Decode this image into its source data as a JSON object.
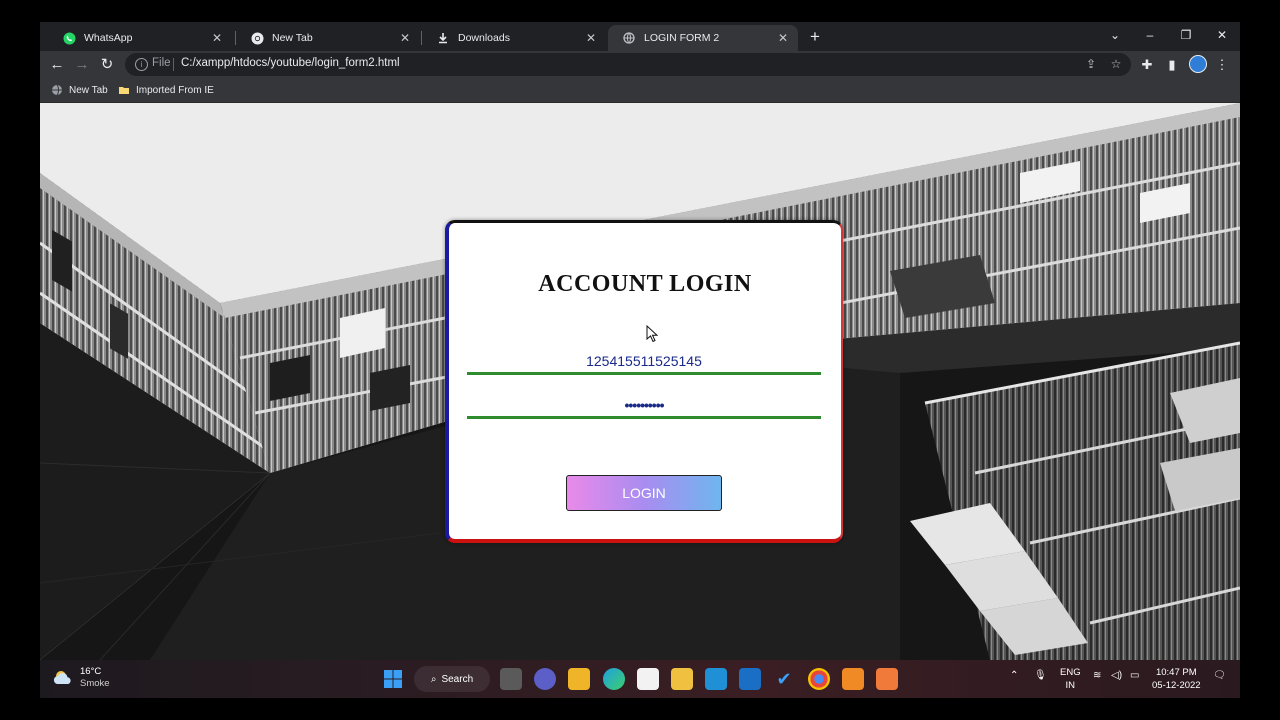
{
  "browser": {
    "tabs": [
      {
        "label": "WhatsApp",
        "icon": "whatsapp-icon"
      },
      {
        "label": "New Tab",
        "icon": "chrome-icon"
      },
      {
        "label": "Downloads",
        "icon": "download-icon"
      },
      {
        "label": "LOGIN FORM 2",
        "icon": "globe-icon",
        "active": true
      }
    ],
    "address": {
      "scheme_label": "File",
      "url": "C:/xampp/htdocs/youtube/login_form2.html"
    },
    "bookmarks": [
      {
        "label": "New Tab",
        "icon": "globe-icon"
      },
      {
        "label": "Imported From IE",
        "icon": "folder-icon"
      }
    ]
  },
  "login": {
    "title": "ACCOUNT LOGIN",
    "username_value": "125415511525145",
    "password_value": "••••••••••",
    "button_label": "LOGIN"
  },
  "taskbar": {
    "weather_temp": "16°C",
    "weather_desc": "Smoke",
    "search_label": "Search",
    "lang_top": "ENG",
    "lang_bottom": "IN",
    "time": "10:47 PM",
    "date": "05-12-2022"
  },
  "colors": {
    "field_underline": "#2e8b2e",
    "input_text": "#1a2a8a",
    "button_gradient_start": "#e98ae9",
    "button_gradient_end": "#6fb6ef"
  }
}
